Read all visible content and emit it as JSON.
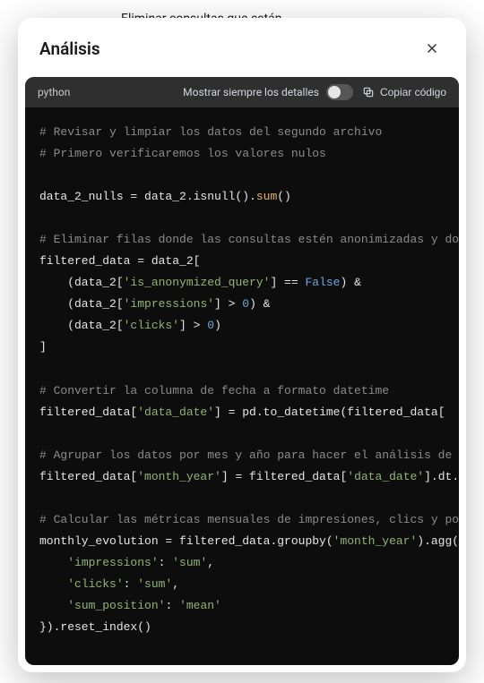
{
  "backdrop": {
    "bullet": "Eliminar consultas que están anonimizadas ("
  },
  "modal": {
    "title": "Análisis"
  },
  "toolbar": {
    "lang": "python",
    "details_label": "Mostrar siempre los detalles",
    "copy_label": "Copiar código"
  },
  "code": {
    "c1": "# Revisar y limpiar los datos del segundo archivo",
    "c2": "# Primero verificaremos los valores nulos",
    "l3a": "data_2_nulls = data_2.isnull().",
    "l3b": "sum",
    "l3c": "()",
    "c4": "# Eliminar filas donde las consultas estén anonimizadas y donde no haya impresiones ni clics",
    "l5": "filtered_data = data_2[",
    "l6a": "    (data_2[",
    "l6b": "'is_anonymized_query'",
    "l6c": "] == ",
    "l6d": "False",
    "l6e": ") &",
    "l7a": "    (data_2[",
    "l7b": "'impressions'",
    "l7c": "] > ",
    "l7d": "0",
    "l7e": ") &",
    "l8a": "    (data_2[",
    "l8b": "'clicks'",
    "l8c": "] > ",
    "l8d": "0",
    "l8e": ")",
    "l9": "]",
    "c10": "# Convertir la columna de fecha a formato datetime",
    "l11a": "filtered_data[",
    "l11b": "'data_date'",
    "l11c": "] = pd.to_datetime(filtered_data[",
    "c12": "# Agrupar los datos por mes y año para hacer el análisis de evolución mensual",
    "l13a": "filtered_data[",
    "l13b": "'month_year'",
    "l13c": "] = filtered_data[",
    "l13d": "'data_date'",
    "l13e": "].dt.to_period(",
    "c14": "# Calcular las métricas mensuales de impresiones, clics y posición promedio",
    "l15a": "monthly_evolution = filtered_data.groupby(",
    "l15b": "'month_year'",
    "l15c": ").agg({",
    "l16a": "    ",
    "l16b": "'impressions'",
    "l16c": ": ",
    "l16d": "'sum'",
    "l16e": ",",
    "l17a": "    ",
    "l17b": "'clicks'",
    "l17c": ": ",
    "l17d": "'sum'",
    "l17e": ",",
    "l18a": "    ",
    "l18b": "'sum_position'",
    "l18c": ": ",
    "l18d": "'mean'",
    "l19": "}).reset_index()"
  }
}
